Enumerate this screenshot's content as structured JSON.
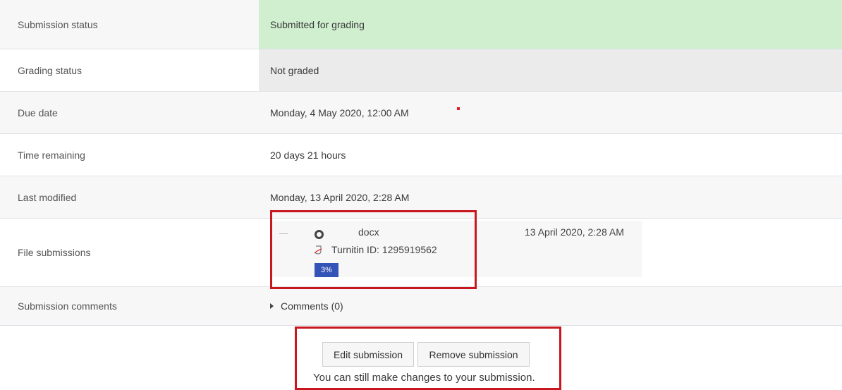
{
  "rows": [
    {
      "label": "Submission status",
      "value": "Submitted for grading"
    },
    {
      "label": "Grading status",
      "value": "Not graded"
    },
    {
      "label": "Due date",
      "value": "Monday, 4 May 2020, 12:00 AM"
    },
    {
      "label": "Time remaining",
      "value": "20 days 21 hours"
    },
    {
      "label": "Last modified",
      "value": "Monday, 13 April 2020, 2:28 AM"
    },
    {
      "label": "File submissions"
    },
    {
      "label": "Submission comments",
      "value": "Comments (0)"
    }
  ],
  "file": {
    "name": "docx",
    "date": "13 April 2020, 2:28 AM",
    "turnitin": "Turnitin ID: 1295919562",
    "similarity": "3%"
  },
  "actions": {
    "edit_label": "Edit submission",
    "remove_label": "Remove submission",
    "help": "You can still make changes to your submission."
  },
  "colors": {
    "submitted_bg": "#cfefcf",
    "notgraded_bg": "#ebebeb",
    "highlight": "#c9171f",
    "badge": "#3453b7"
  },
  "icons": {
    "file": "file-circle-icon",
    "turnitin": "turnitin-icon",
    "caret": "caret-right-icon"
  }
}
